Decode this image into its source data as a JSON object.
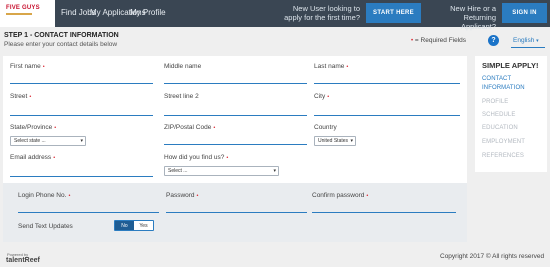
{
  "brand": {
    "logo_text": "FIVE GUYS"
  },
  "nav": {
    "links": [
      "Find Jobs",
      "My Applications",
      "My Profile"
    ]
  },
  "promo_new": {
    "line1": "New User looking to",
    "line2": "apply for the first time?",
    "button": "START HERE"
  },
  "promo_return": {
    "line1": "New Hire or a",
    "line2": "Returning Applicant?",
    "button": "SIGN IN"
  },
  "heading": {
    "title": "STEP 1 - CONTACT INFORMATION",
    "subtitle": "Please enter your contact details below",
    "required_legend": "= Required Fields",
    "help_icon": "?",
    "language": "English"
  },
  "form": {
    "first_name": "First name",
    "middle_name": "Middle name",
    "last_name": "Last name",
    "street": "Street",
    "street2": "Street line 2",
    "city": "City",
    "state": "State/Province",
    "state_value": "Select state ...",
    "zip": "ZIP/Postal Code",
    "country": "Country",
    "country_value": "United States",
    "email": "Email address",
    "referral": "How did you find us?",
    "referral_value": "Select ...",
    "login_phone": "Login Phone No.",
    "password": "Password",
    "confirm_password": "Confirm password",
    "send_text": "Send Text Updates",
    "toggle_no": "No",
    "toggle_yes": "Yes"
  },
  "sidebar": {
    "title": "SIMPLE APPLY!",
    "active_line1": "CONTACT",
    "active_line2": "INFORMATION",
    "items": [
      "PROFILE",
      "SCHEDULE",
      "EDUCATION",
      "EMPLOYMENT",
      "REFERENCES"
    ]
  },
  "footer": {
    "powered": "Powered by",
    "brand": "talentReef",
    "copyright": "Copyright 2017 © All rights reserved"
  },
  "colors": {
    "accent": "#2b7cc0",
    "topbar": "#3a4653",
    "required": "#d9232e"
  }
}
